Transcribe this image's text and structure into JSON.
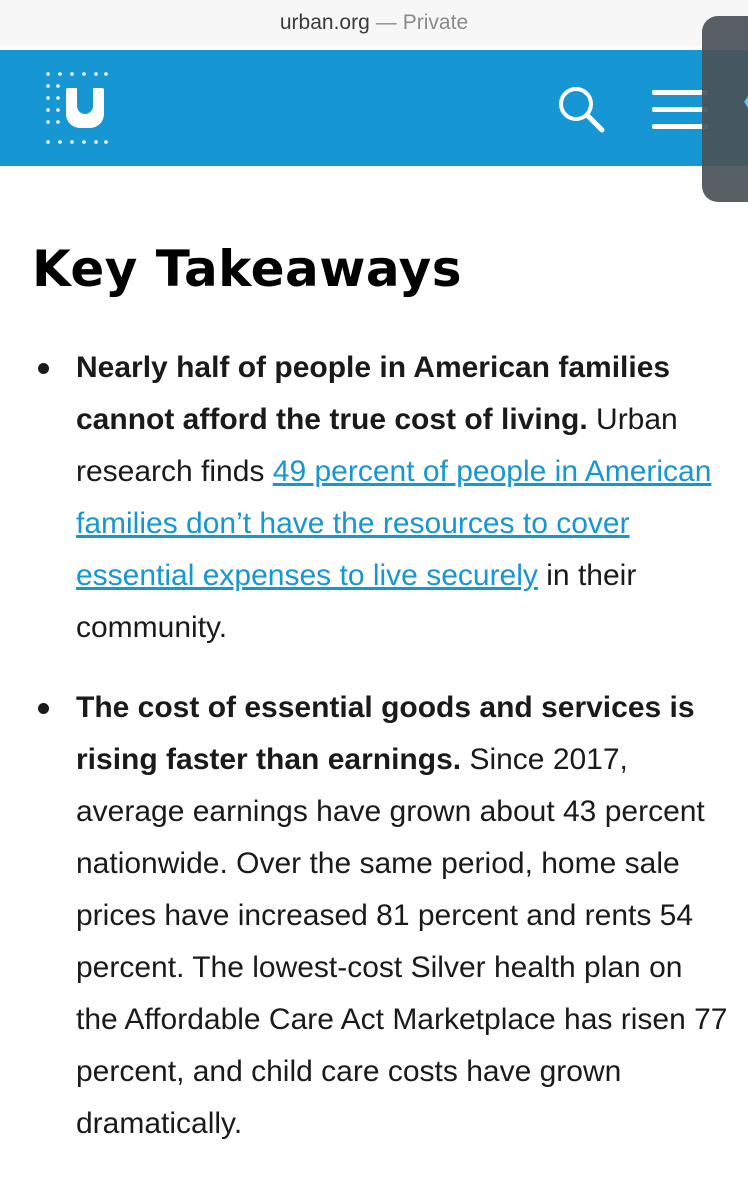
{
  "browser": {
    "domain": "urban.org",
    "separator": "—",
    "mode": "Private"
  },
  "nav": {
    "logo_letter": "U",
    "colors": {
      "nav_bg": "#1696d2",
      "link": "#1696d2"
    },
    "icons": [
      "search-icon",
      "hamburger-menu-icon",
      "chevron-left-icon"
    ]
  },
  "page": {
    "heading": "Key Takeaways",
    "takeaways": [
      {
        "bold": "Nearly half of people in American families cannot afford the true cost of living.",
        "text_before": "Urban research finds",
        "link": "49 percent of people in American families don’t have the resources to cover essential expenses to live securely",
        "text_after": "in their community."
      },
      {
        "bold": "The cost of essential goods and services is rising faster than earnings.",
        "text": "Since 2017, average earnings have grown about 43 percent nationwide. Over the same period, home sale prices have increased 81 percent and rents 54 percent. The lowest-cost Silver health plan on the Affordable Care Act Marketplace has risen 77 percent, and child care costs have grown dramatically."
      }
    ]
  }
}
